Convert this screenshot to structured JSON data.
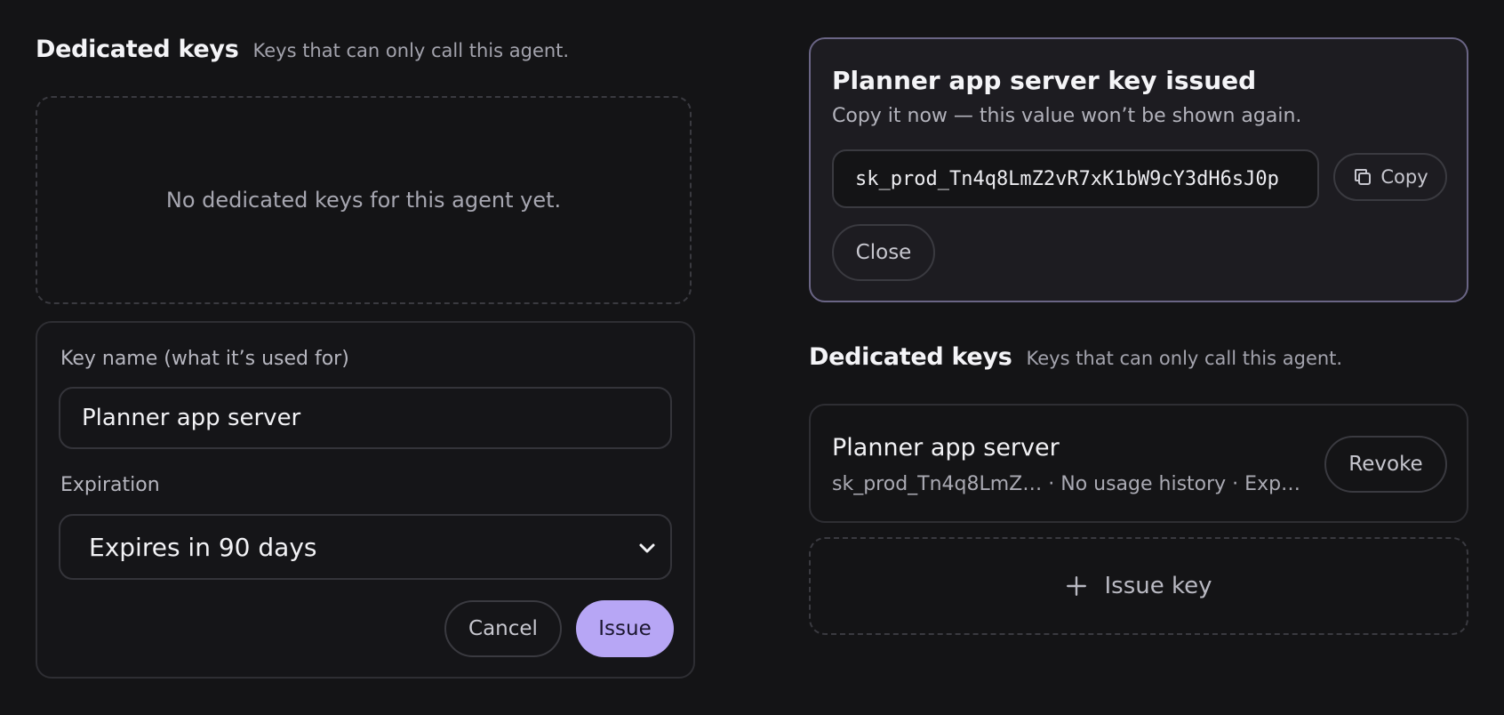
{
  "left": {
    "section": {
      "title": "Dedicated keys",
      "subtitle": "Keys that can only call this agent."
    },
    "empty_text": "No dedicated keys for this agent yet.",
    "form": {
      "name_label": "Key name (what it’s used for)",
      "name_value": "Planner app server",
      "expiration_label": "Expiration",
      "expiration_value": "Expires in 90 days",
      "cancel_label": "Cancel",
      "issue_label": "Issue"
    }
  },
  "right": {
    "issued": {
      "title": "Planner app server key issued",
      "subtitle": "Copy it now — this value won’t be shown again.",
      "key_value": "sk_prod_Tn4q8LmZ2vR7xK1bW9cY3dH6sJ0p",
      "copy_label": "Copy",
      "close_label": "Close"
    },
    "section": {
      "title": "Dedicated keys",
      "subtitle": "Keys that can only call this agent."
    },
    "key_row": {
      "name": "Planner app server",
      "meta": "sk_prod_Tn4q8LmZ… · No usage history · Exp…",
      "revoke_label": "Revoke"
    },
    "add_label": "Issue key"
  },
  "icons": {
    "copy": "copy-icon",
    "plus": "plus-icon",
    "chevron": "chevron-down-icon"
  },
  "colors": {
    "accent": "#b7a6f5",
    "background": "#141416",
    "issued_border": "#6a6585"
  }
}
